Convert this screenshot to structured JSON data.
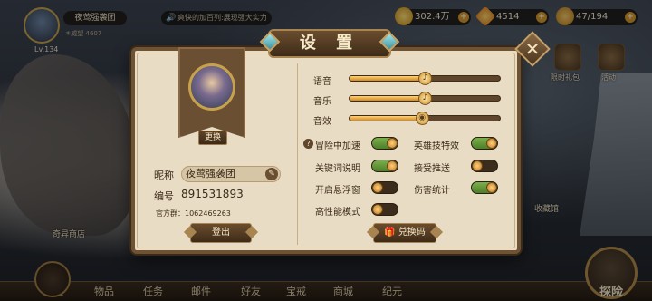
{
  "player": {
    "name": "夜莺强袭团",
    "level": "Lv.134",
    "fame_label": "⚜威望",
    "fame_value": "4607"
  },
  "ticker": {
    "text": "爽快的加百列:展现强大实力"
  },
  "resources": {
    "gold": "302.4万",
    "gems": "4514",
    "stamina": "47/194"
  },
  "side_labels": {
    "gift": "限时礼包",
    "activity": "活动"
  },
  "scene_labels": {
    "shop": "奇异商店",
    "collection": "收藏馆"
  },
  "settings": {
    "title": "设 置",
    "change_portrait": "更换",
    "nickname_label": "昵称",
    "nickname": "夜莺强袭团",
    "id_label": "编号",
    "id": "891531893",
    "qq_group": "官方群：1062469263",
    "logout": "登出",
    "redeem": "兑换码",
    "sliders": [
      {
        "label": "语音",
        "level": 0.5
      },
      {
        "label": "音乐",
        "level": 0.5
      },
      {
        "label": "音效",
        "level": 0.48
      }
    ],
    "toggles": [
      {
        "label": "冒险中加速",
        "on": true
      },
      {
        "label": "英雄技特效",
        "on": true
      },
      {
        "label": "关键词说明",
        "on": true
      },
      {
        "label": "接受推送",
        "on": false
      },
      {
        "label": "开启悬浮窗",
        "on": false
      },
      {
        "label": "伤害统计",
        "on": true
      },
      {
        "label": "高性能模式",
        "on": false
      }
    ]
  },
  "bottom_nav": {
    "hero": "英雄",
    "items": "物品",
    "tasks": "任务",
    "mail": "邮件",
    "friends": "好友",
    "ring": "宝戒",
    "store": "商城",
    "annals": "纪元",
    "explore": "探险"
  },
  "colors": {
    "accent_gold": "#c8a24a",
    "panel_bg": "#e9dcc4",
    "toggle_on": "#6aa03e"
  }
}
